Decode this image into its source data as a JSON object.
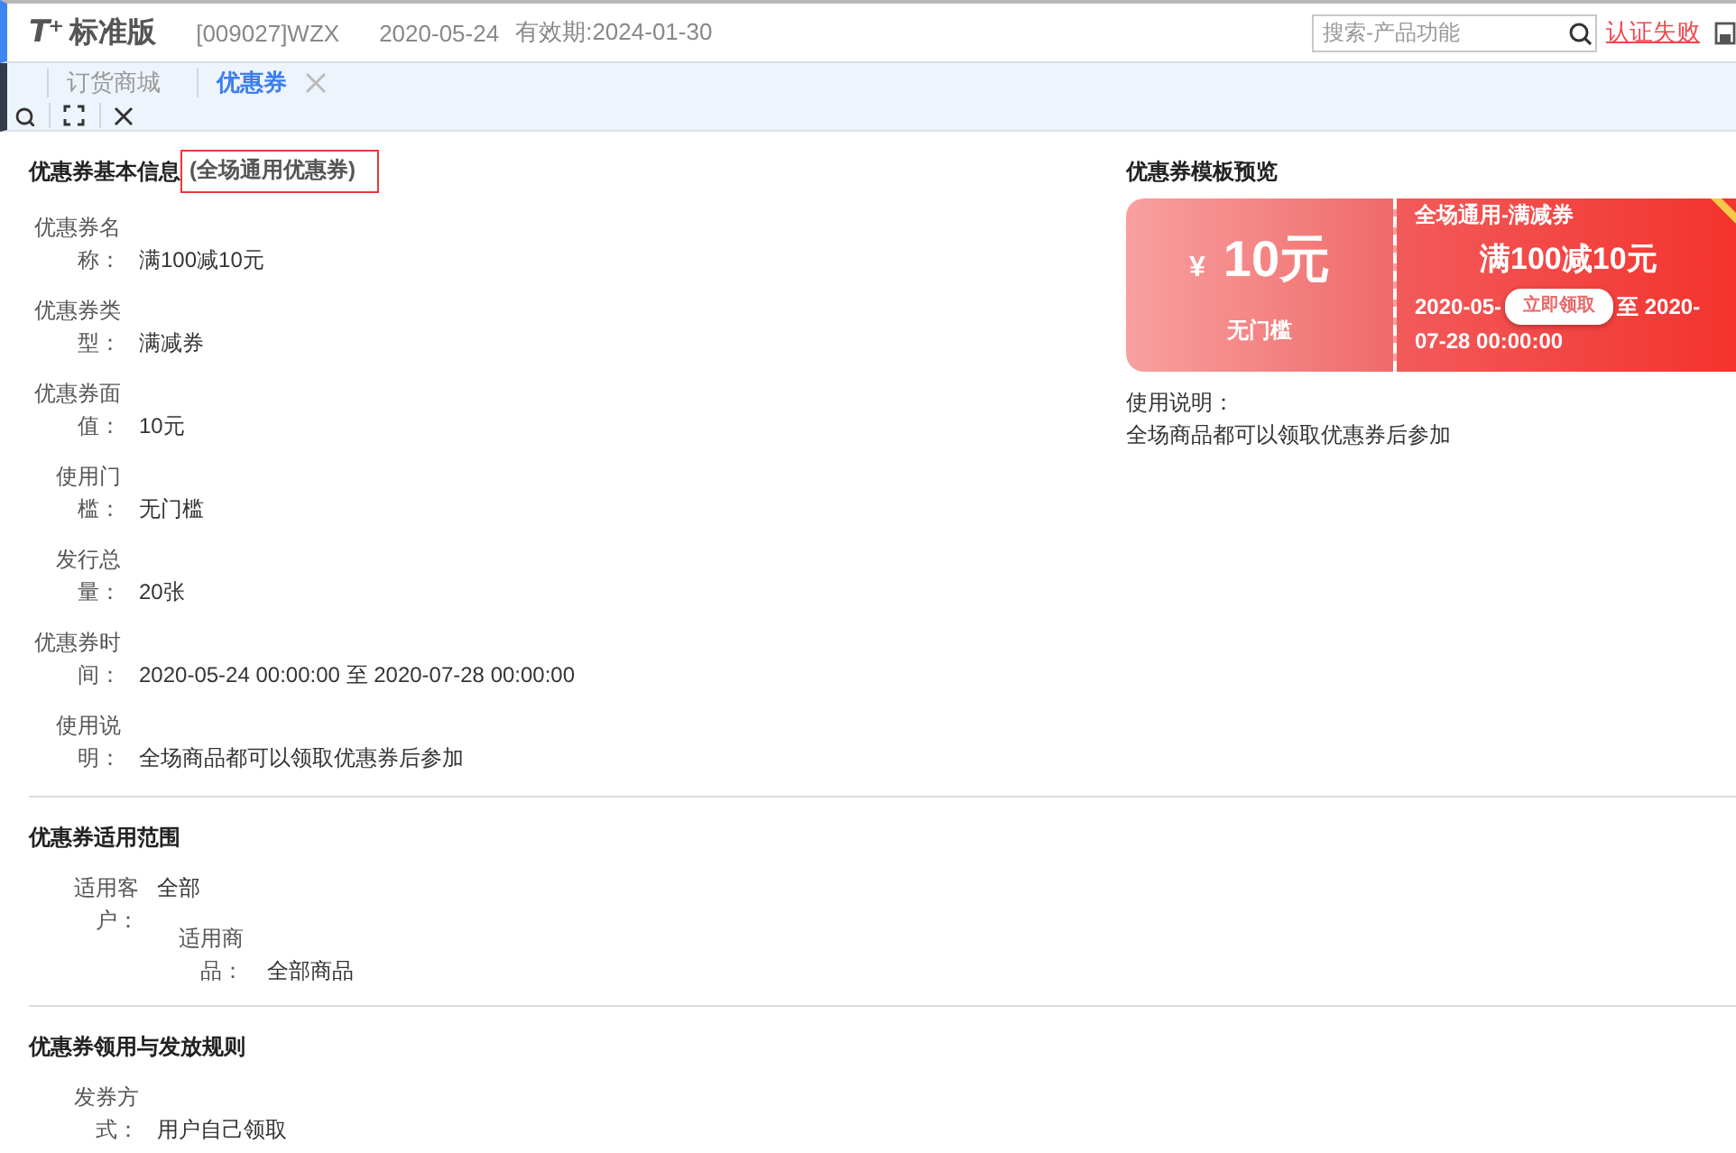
{
  "header": {
    "logo_mark": "T⁺",
    "product": "标准版",
    "account": "[009027]WZX",
    "date": "2020-05-24",
    "validity": "有效期:2024-01-30",
    "search": {
      "placeholder": "搜索-产品功能"
    },
    "auth_link": "认证失败"
  },
  "tabs": [
    {
      "label": "订货商城",
      "selected": false,
      "closable": false
    },
    {
      "label": "优惠券",
      "selected": true,
      "closable": true
    }
  ],
  "basic_info": {
    "title": "优惠券基本信息",
    "tag": "(全场通用优惠券)",
    "fields": [
      {
        "label": "优惠券名称：",
        "value": "满100减10元"
      },
      {
        "label": "优惠券类型：",
        "value": "满减券"
      },
      {
        "label": "优惠券面值：",
        "value": "10元"
      },
      {
        "label": "使用门槛：",
        "value": "无门槛"
      },
      {
        "label": "发行总量：",
        "value": "20张"
      },
      {
        "label": "优惠券时间：",
        "value": "2020-05-24 00:00:00 至 2020-07-28 00:00:00"
      },
      {
        "label": "使用说明：",
        "value": "全场商品都可以领取优惠券后参加"
      }
    ]
  },
  "preview": {
    "title": "优惠券模板预览",
    "coupon": {
      "currency": "¥",
      "amount": "10元",
      "threshold": "无门槛",
      "name": "全场通用-满减券",
      "rule": "满100减10元",
      "date_parts": [
        "2020-05-",
        "至 2020-",
        "07-28 00:00:00"
      ],
      "button": "立即领取"
    },
    "usage_label": "使用说明：",
    "usage_text": "全场商品都可以领取优惠券后参加"
  },
  "scope": {
    "title": "优惠券适用范围",
    "fields": [
      {
        "label": "适用客户：",
        "value": "全部",
        "children": [
          {
            "label": "适用商品：",
            "value": "全部商品"
          }
        ]
      }
    ]
  },
  "rules": {
    "title": "优惠券领用与发放规则",
    "fields": [
      {
        "label": "发券方式：",
        "value": "用户自己领取"
      }
    ]
  }
}
